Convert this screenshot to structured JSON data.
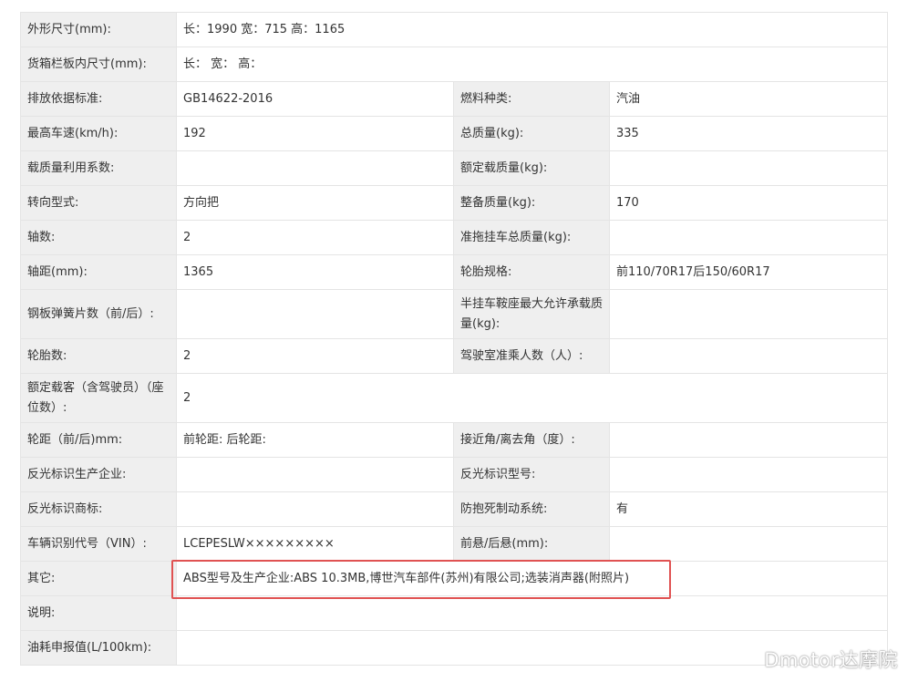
{
  "rows": [
    {
      "l1": "外形尺寸(mm):",
      "v1": "长：1990 宽：715 高：1165"
    },
    {
      "l1": "货箱栏板内尺寸(mm):",
      "v1": "长：  宽：  高："
    },
    {
      "l1": "排放依据标准:",
      "v1": "GB14622-2016",
      "l2": "燃料种类:",
      "v2": "汽油"
    },
    {
      "l1": "最高车速(km/h):",
      "v1": "192",
      "l2": "总质量(kg):",
      "v2": "335"
    },
    {
      "l1": "载质量利用系数:",
      "v1": "",
      "l2": "额定载质量(kg):",
      "v2": ""
    },
    {
      "l1": "转向型式:",
      "v1": "方向把",
      "l2": "整备质量(kg):",
      "v2": "170"
    },
    {
      "l1": "轴数:",
      "v1": "2",
      "l2": "准拖挂车总质量(kg):",
      "v2": ""
    },
    {
      "l1": "轴距(mm):",
      "v1": "1365",
      "l2": "轮胎规格:",
      "v2": "前110/70R17后150/60R17"
    },
    {
      "l1": "钢板弹簧片数（前/后）:",
      "v1": "",
      "l2": "半挂车鞍座最大允许承载质量(kg):",
      "v2": ""
    },
    {
      "l1": "轮胎数:",
      "v1": "2",
      "l2": "驾驶室准乘人数（人）:",
      "v2": ""
    },
    {
      "l1": "额定载客（含驾驶员）（座位数）:",
      "v1": "2"
    },
    {
      "l1": "轮距（前/后)mm:",
      "v1": "前轮距: 后轮距:",
      "l2": "接近角/离去角（度）:",
      "v2": ""
    },
    {
      "l1": "反光标识生产企业:",
      "v1": "",
      "l2": "反光标识型号:",
      "v2": ""
    },
    {
      "l1": "反光标识商标:",
      "v1": "",
      "l2": "防抱死制动系统:",
      "v2": "有"
    },
    {
      "l1": "车辆识别代号（VIN）:",
      "v1": "LCEPESLW×××××××××",
      "l2": "前悬/后悬(mm):",
      "v2": ""
    },
    {
      "l1": "其它:",
      "v1": "ABS型号及生产企业:ABS 10.3MB,博世汽车部件(苏州)有限公司;选装消声器(附照片)"
    },
    {
      "l1": "说明:",
      "v1": ""
    },
    {
      "l1": "油耗申报值(L/100km):",
      "v1": ""
    }
  ],
  "watermark": "Dmotor达摩院",
  "highlight_color": "#e05252"
}
